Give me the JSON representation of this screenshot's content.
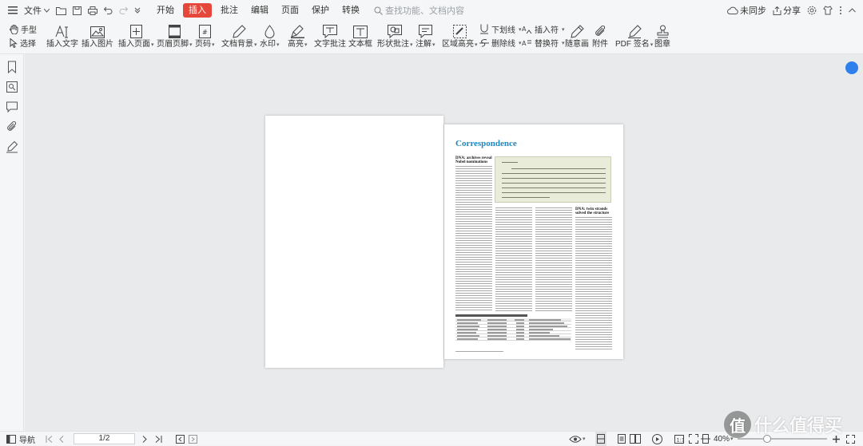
{
  "menubar": {
    "file_label": "文件",
    "tabs": [
      {
        "label": "开始"
      },
      {
        "label": "插入"
      },
      {
        "label": "批注"
      },
      {
        "label": "编辑"
      },
      {
        "label": "页面"
      },
      {
        "label": "保护"
      },
      {
        "label": "转换"
      }
    ],
    "active_tab": "插入",
    "search_placeholder": "查找功能、文档内容",
    "sync_label": "未同步",
    "share_label": "分享"
  },
  "toolbar": {
    "hand_label": "手型",
    "select_label": "选择",
    "insert_text": "插入文字",
    "insert_image": "插入图片",
    "insert_page": "插入页面",
    "header_footer": "页眉页脚",
    "page_number": "页码",
    "doc_background": "文档背景",
    "watermark": "水印",
    "highlight": "高亮",
    "text_comment": "文字批注",
    "textbox": "文本框",
    "shape_comment": "形状批注",
    "annotation": "注解",
    "area_highlight": "区域高亮",
    "underline": "下划线",
    "strikethrough": "删除线",
    "insert_symbol": "插入符",
    "replace_symbol": "替换符",
    "freehand": "随意画",
    "attachment": "附件",
    "pdf_signature": "PDF 签名",
    "stamp": "图章"
  },
  "document": {
    "correspondence_title": "Correspondence",
    "left_headline": "DNA: archives reveal Nobel nominations",
    "right_headline": "DNA: twin strands solved the structure"
  },
  "statusbar": {
    "nav_label": "导航",
    "page_indicator": "1/2",
    "zoom": "40%"
  },
  "watermark": {
    "text": "什么值得买",
    "badge": "值"
  },
  "colors": {
    "accent": "#e5483b",
    "correspondence_blue": "#1f87c0"
  }
}
